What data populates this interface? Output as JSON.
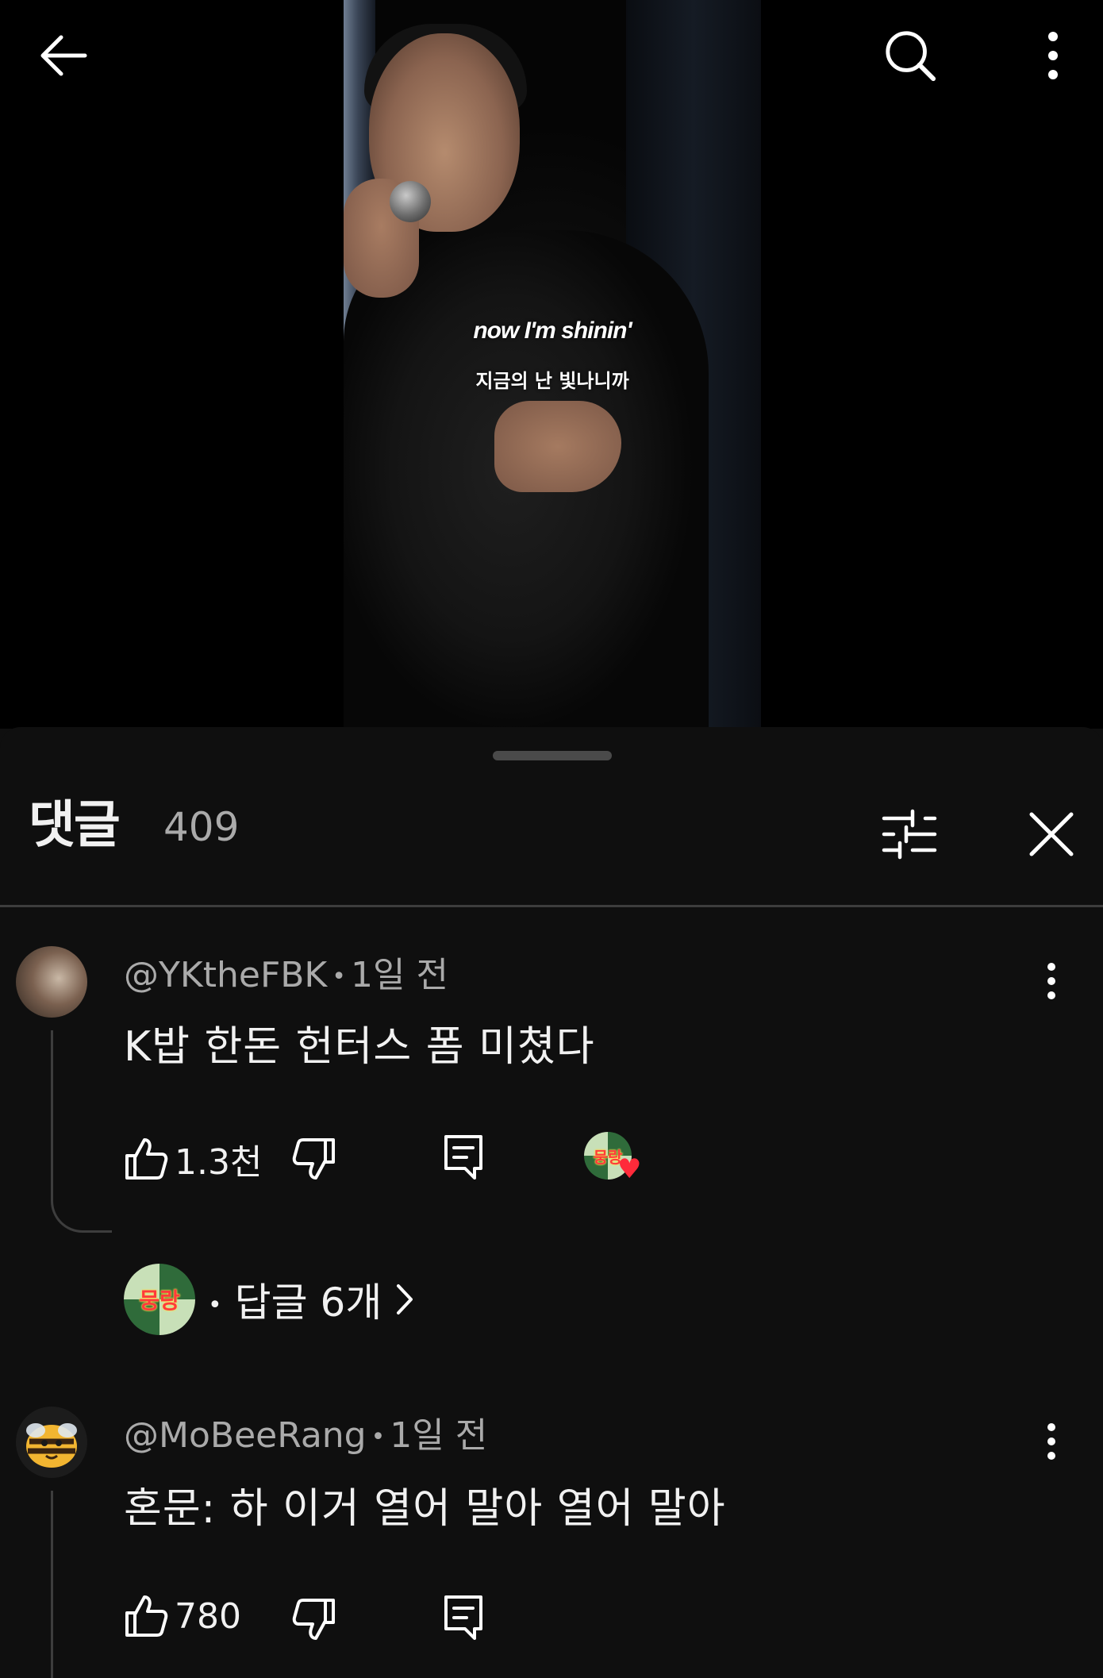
{
  "video": {
    "caption_en": "now I'm shinin'",
    "caption_ko": "지금의 난 빛나니까"
  },
  "topbar": {
    "back_icon": "arrow-left-icon",
    "search_icon": "search-icon",
    "more_icon": "more-vert-icon"
  },
  "comments_panel": {
    "title": "댓글",
    "count": "409",
    "sort_icon": "tune-icon",
    "close_icon": "close-icon"
  },
  "comments": [
    {
      "author": "@YKtheFBK",
      "time": "1일 전",
      "text": "K밥 한돈 헌터스 폼 미쳤다",
      "likes": "1.3천",
      "creator_heart": true,
      "creator_monogram": "뭉랑",
      "reply_count_label": "답글 6개"
    },
    {
      "author": "@MoBeeRang",
      "time": "1일 전",
      "text": "혼문: 하 이거 열어 말아 열어 말아",
      "likes": "780"
    }
  ],
  "colors": {
    "background": "#0f0f0f",
    "text_primary": "#f1f1f1",
    "text_secondary": "#aaaaaa",
    "divider": "#3d3d3d",
    "heart": "#ff2a3a"
  }
}
